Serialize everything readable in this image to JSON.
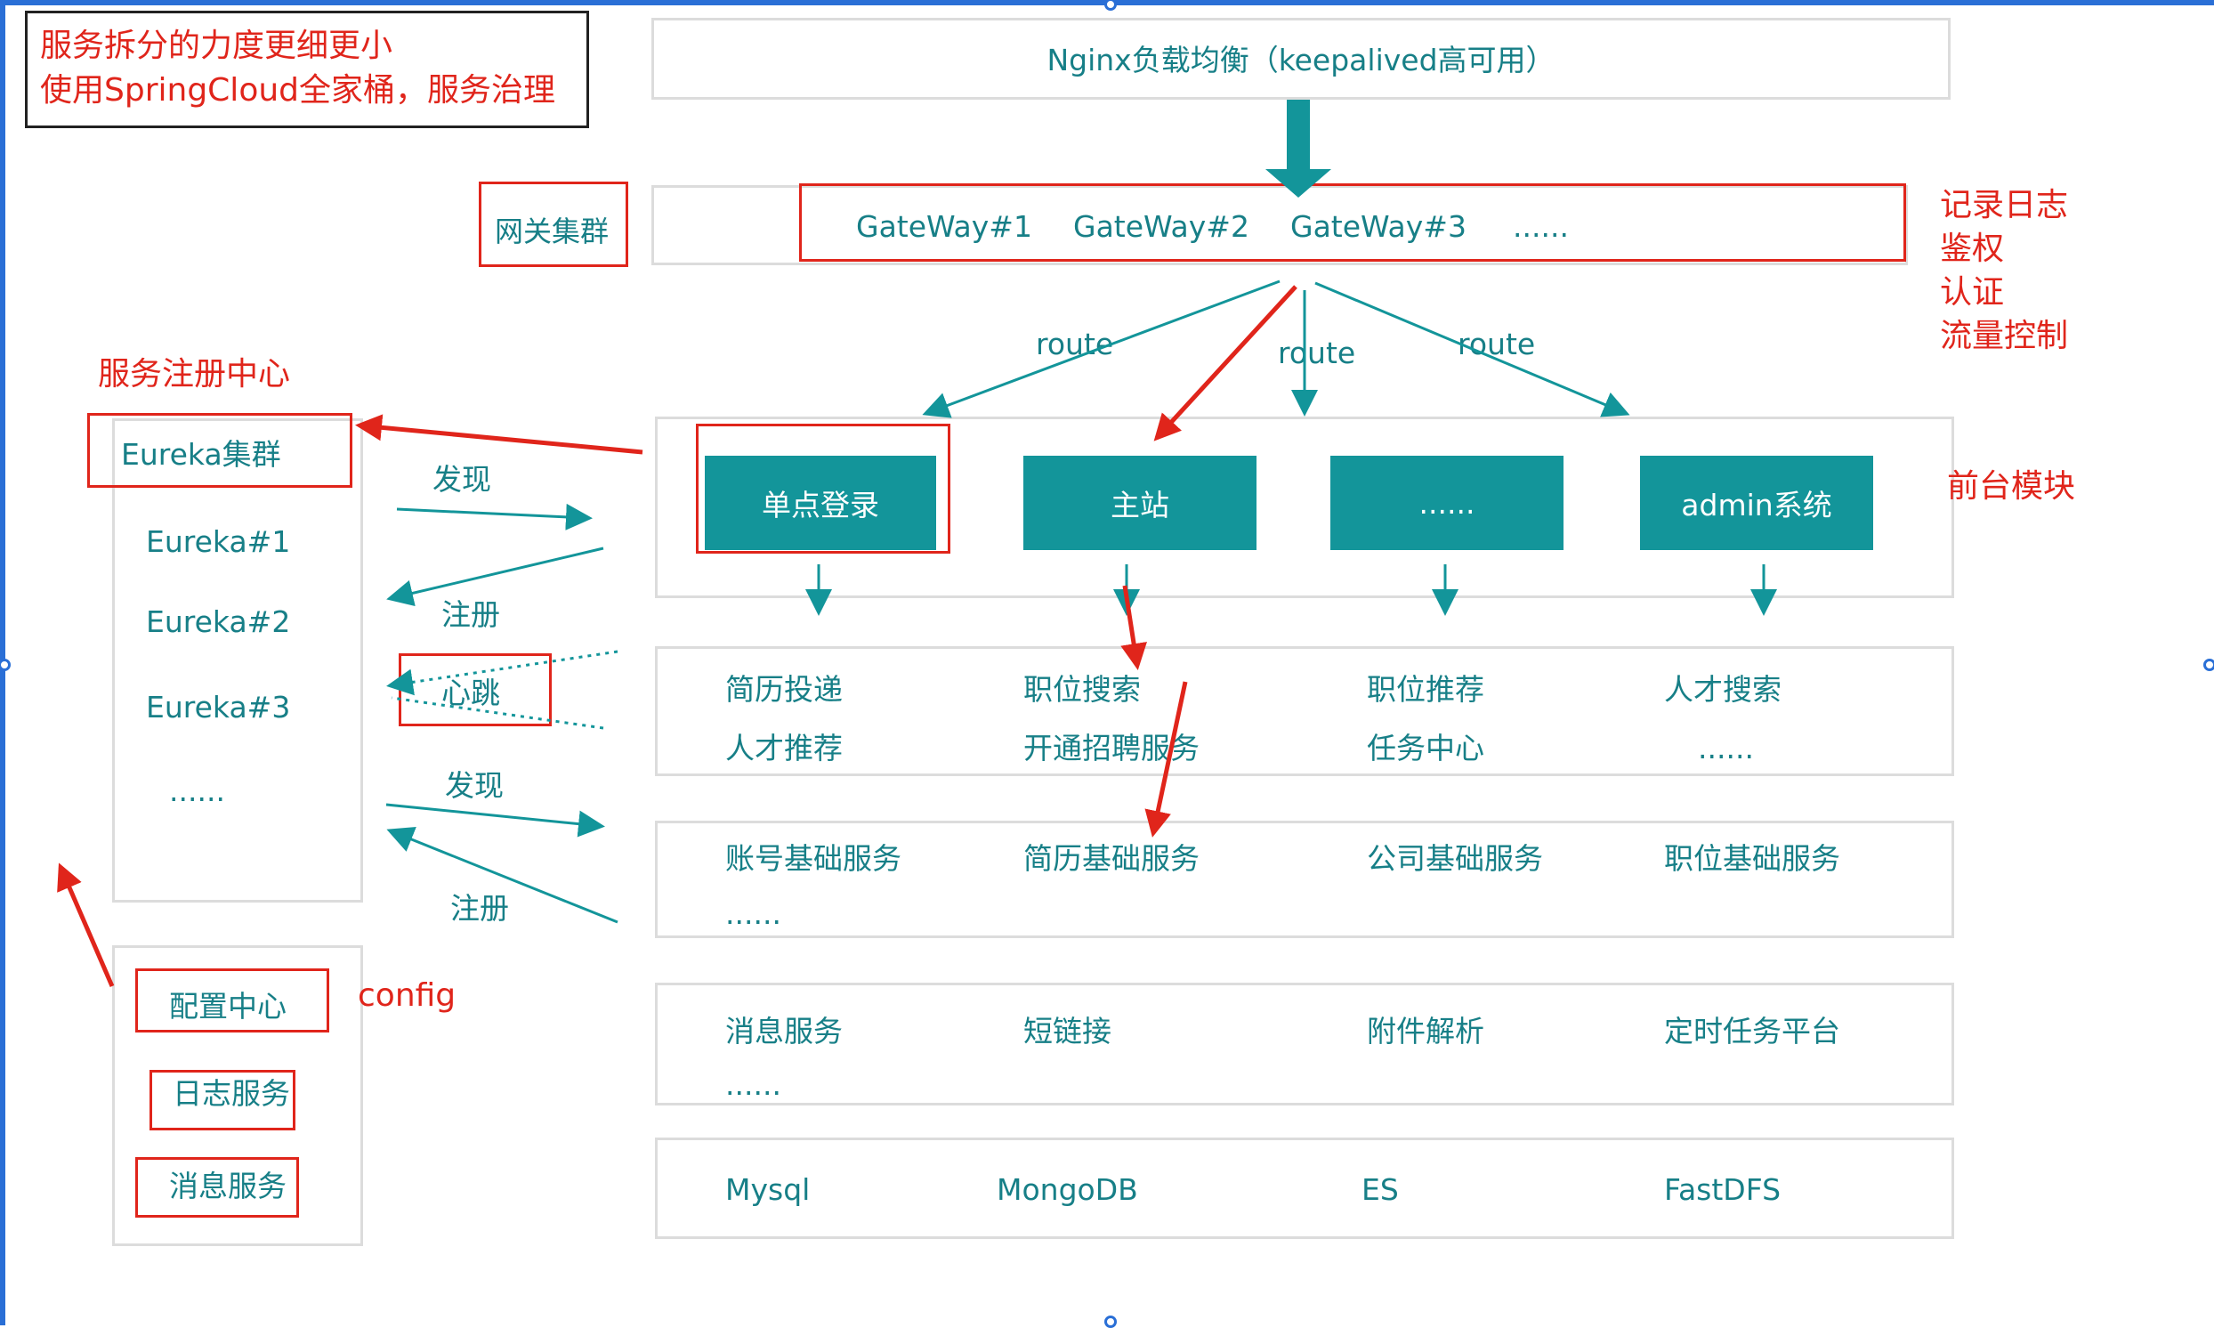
{
  "note": {
    "line1": "服务拆分的力度更细更小",
    "line2": "使用SpringCloud全家桶，服务治理"
  },
  "nginx": "Nginx负载均衡（keepalived高可用）",
  "gateway": {
    "label": "网关集群",
    "items": [
      "GateWay#1",
      "GateWay#2",
      "GateWay#3",
      "......"
    ],
    "side_notes": [
      "记录日志",
      "鉴权",
      "认证",
      "流量控制"
    ]
  },
  "route_labels": [
    "route",
    "route",
    "route"
  ],
  "registry": {
    "title": "服务注册中心",
    "cluster": "Eureka集群",
    "nodes": [
      "Eureka#1",
      "Eureka#2",
      "Eureka#3",
      "......"
    ]
  },
  "flows": {
    "discover1": "发现",
    "register1": "注册",
    "heartbeat": "心跳",
    "discover2": "发现",
    "register2": "注册"
  },
  "frontend": {
    "label": "前台模块",
    "modules": [
      "单点登录",
      "主站",
      "......",
      "admin系统"
    ]
  },
  "business": {
    "col1": [
      "简历投递",
      "人才推荐"
    ],
    "col2": [
      "职位搜索",
      "开通招聘服务"
    ],
    "col3": [
      "职位推荐",
      "任务中心"
    ],
    "col4": [
      "人才搜索",
      "......"
    ]
  },
  "base_services": [
    "账号基础服务",
    "简历基础服务",
    "公司基础服务",
    "职位基础服务",
    "......"
  ],
  "common_services": [
    "消息服务",
    "短链接",
    "附件解析",
    "定时任务平台",
    "......"
  ],
  "storage": [
    "Mysql",
    "MongoDB",
    "ES",
    "FastDFS"
  ],
  "infra": {
    "config_label": "config",
    "items": [
      "配置中心",
      "日志服务",
      "消息服务"
    ]
  },
  "colors": {
    "teal": "#13959a",
    "teal_text": "#177f87",
    "red": "#e0251b",
    "lane_border": "#dcdcdc",
    "selection_blue": "#2a6fd6"
  }
}
